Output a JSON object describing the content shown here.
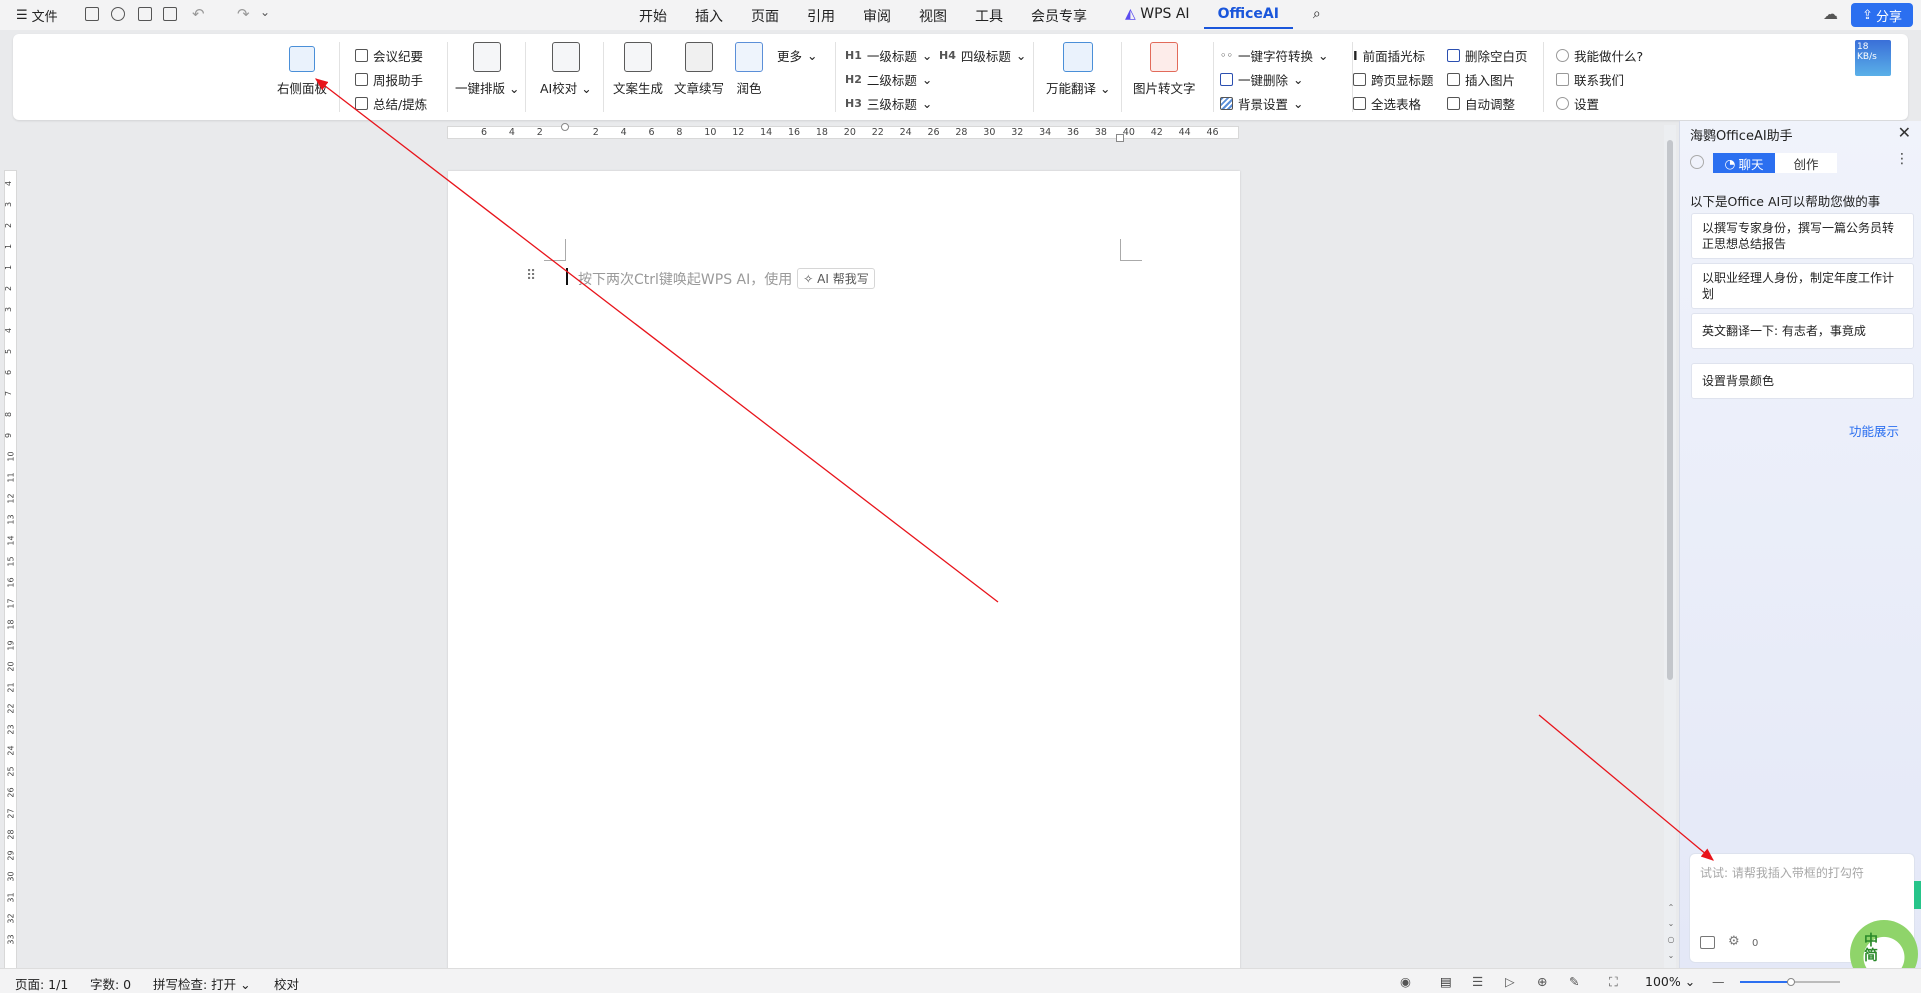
{
  "topbar": {
    "file_label": "文件",
    "tabs": [
      "开始",
      "插入",
      "页面",
      "引用",
      "审阅",
      "视图",
      "工具",
      "会员专享",
      "WPS AI",
      "OfficeAI"
    ],
    "active_tab": "OfficeAI",
    "share_label": "分享"
  },
  "ribbon": {
    "right_panel": "右侧面板",
    "meeting_minutes": "会议纪要",
    "weekly_report": "周报助手",
    "summary": "总结/提炼",
    "one_click_layout": "一键排版",
    "ai_proofread": "AI校对",
    "copy_generate": "文案生成",
    "continue_writing": "文章续写",
    "polish": "润色",
    "more": "更多",
    "h1": "一级标题",
    "h2": "二级标题",
    "h3": "三级标题",
    "h4": "四级标题",
    "translate": "万能翻译",
    "img_to_text": "图片转文字",
    "char_convert": "一键字符转换",
    "one_click_delete": "一键删除",
    "bg_settings": "背景设置",
    "insert_cursor_front": "前面插光标",
    "cross_page_header": "跨页显标题",
    "select_all_tables": "全选表格",
    "delete_blank_pages": "删除空白页",
    "insert_image": "插入图片",
    "auto_adjust": "自动调整",
    "what_can_i_do": "我能做什么?",
    "contact_us": "联系我们",
    "settings": "设置",
    "speed_badge": "18 KB/s"
  },
  "ruler": {
    "ticks": [
      "6",
      "4",
      "2",
      "2",
      "4",
      "6",
      "8",
      "10",
      "12",
      "14",
      "16",
      "18",
      "20",
      "22",
      "24",
      "26",
      "28",
      "30",
      "32",
      "34",
      "36",
      "38",
      "40",
      "42",
      "44",
      "46"
    ],
    "vticks_top": [
      "4",
      "3",
      "2",
      "1"
    ],
    "vticks": [
      "1",
      "2",
      "3",
      "4",
      "5",
      "6",
      "7",
      "8",
      "9",
      "10",
      "11",
      "12",
      "13",
      "14",
      "15",
      "16",
      "17",
      "18",
      "19",
      "20",
      "21",
      "22",
      "23",
      "24",
      "25",
      "26",
      "27",
      "28",
      "29",
      "30",
      "31",
      "32",
      "33"
    ]
  },
  "document": {
    "placeholder": "按下两次Ctrl键唤起WPS AI，使用",
    "ai_chip": "AI 帮我写"
  },
  "panel": {
    "title": "海鹦OfficeAI助手",
    "tab_chat": "聊天",
    "tab_create": "创作",
    "intro": "以下是Office AI可以帮助您做的事",
    "suggestions": [
      "以撰写专家身份，撰写一篇公务员转正思想总结报告",
      "以职业经理人身份，制定年度工作计划",
      "英文翻译一下: 有志者，事竟成",
      "设置背景颜色"
    ],
    "feature_link": "功能展示",
    "chat_placeholder": "试试: 请帮我插入带框的打勾符",
    "counter": "0",
    "ime_badge": "中\n简"
  },
  "status": {
    "page": "页面: 1/1",
    "words": "字数: 0",
    "spell": "拼写检查: 打开",
    "proof": "校对",
    "zoom": "100%"
  },
  "colors": {
    "accent": "#2b6ff0",
    "arrow": "#e8141b"
  }
}
